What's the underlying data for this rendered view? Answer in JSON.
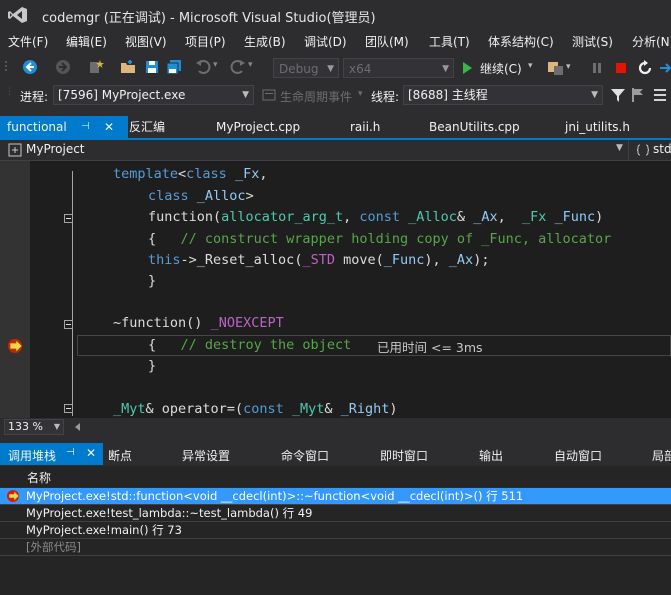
{
  "window": {
    "title": "codemgr (正在调试) - Microsoft Visual Studio(管理员)"
  },
  "menu": [
    "文件(F)",
    "编辑(E)",
    "视图(V)",
    "项目(P)",
    "生成(B)",
    "调试(D)",
    "团队(M)",
    "工具(T)",
    "体系结构(C)",
    "测试(S)",
    "分析(N)"
  ],
  "toolbar": {
    "config": "Debug",
    "platform": "x64",
    "continue_label": "继续(C)"
  },
  "process_bar": {
    "process_label": "进程:",
    "process_value": "[7596] MyProject.exe",
    "lifecycle_label": "生命周期事件",
    "thread_label": "线程:",
    "thread_value": "[8688] 主线程"
  },
  "tabs": [
    "functional",
    "反汇编",
    "MyProject.cpp",
    "raii.h",
    "BeanUtilits.cpp",
    "jni_utilits.h"
  ],
  "nav": {
    "project": "MyProject",
    "member": "std"
  },
  "editor": {
    "zoom": "133 %",
    "lines": [
      [
        [
          "kw",
          "template"
        ],
        [
          "op",
          "<"
        ],
        [
          "kw",
          "class "
        ],
        [
          "pm",
          "_Fx"
        ],
        [
          "op",
          ","
        ]
      ],
      [
        [
          "kw",
          "class "
        ],
        [
          "pm",
          "_Alloc"
        ],
        [
          "op",
          ">"
        ]
      ],
      [
        [
          "id",
          "function"
        ],
        [
          "op",
          "("
        ],
        [
          "ty",
          "allocator_arg_t"
        ],
        [
          "op",
          ", "
        ],
        [
          "kw",
          "const "
        ],
        [
          "ty",
          "_Alloc"
        ],
        [
          "op",
          "& "
        ],
        [
          "pm",
          "_Ax"
        ],
        [
          "op",
          ",  "
        ],
        [
          "ty",
          "_Fx "
        ],
        [
          "pm",
          "_Func"
        ],
        [
          "op",
          ")"
        ]
      ],
      [
        [
          "op",
          "{   "
        ],
        [
          "cm",
          "// construct wrapper holding copy of _Func, allocator"
        ]
      ],
      [
        [
          "kw",
          "this"
        ],
        [
          "op",
          "->"
        ],
        [
          "id",
          "_Reset_alloc"
        ],
        [
          "op",
          "("
        ],
        [
          "mc",
          "_STD "
        ],
        [
          "id",
          "move"
        ],
        [
          "op",
          "("
        ],
        [
          "pm",
          "_Func"
        ],
        [
          "op",
          "), "
        ],
        [
          "pm",
          "_Ax"
        ],
        [
          "op",
          ");"
        ]
      ],
      [
        [
          "op",
          "}"
        ]
      ],
      [],
      [
        [
          "op",
          "~"
        ],
        [
          "id",
          "function"
        ],
        [
          "op",
          "() "
        ],
        [
          "mc",
          "_NOEXCEPT"
        ]
      ],
      [
        [
          "op",
          "{   "
        ],
        [
          "cm",
          "// destroy the object"
        ]
      ],
      [
        [
          "op",
          "}"
        ]
      ],
      [],
      [
        [
          "ty",
          "_Myt"
        ],
        [
          "op",
          "& "
        ],
        [
          "id",
          "operator"
        ],
        [
          "op",
          "=("
        ],
        [
          "kw",
          "const "
        ],
        [
          "ty",
          "_Myt"
        ],
        [
          "op",
          "& "
        ],
        [
          "pm",
          "_Right"
        ],
        [
          "op",
          ")"
        ]
      ]
    ],
    "perf_tip": "已用时间 <= 3ms"
  },
  "panel_tabs": [
    "调用堆栈",
    "断点",
    "异常设置",
    "命令窗口",
    "即时窗口",
    "输出",
    "自动窗口",
    "局部"
  ],
  "callstack": {
    "header": "名称",
    "rows": [
      "MyProject.exe!std::function<void __cdecl(int)>::~function<void __cdecl(int)>() 行 511",
      "MyProject.exe!test_lambda::~test_lambda() 行 49",
      "MyProject.exe!main() 行 73",
      "[外部代码]"
    ]
  },
  "colors": {
    "accent": "#007acc",
    "selection": "#3399ff",
    "editor_bg": "#1e1e1e"
  }
}
